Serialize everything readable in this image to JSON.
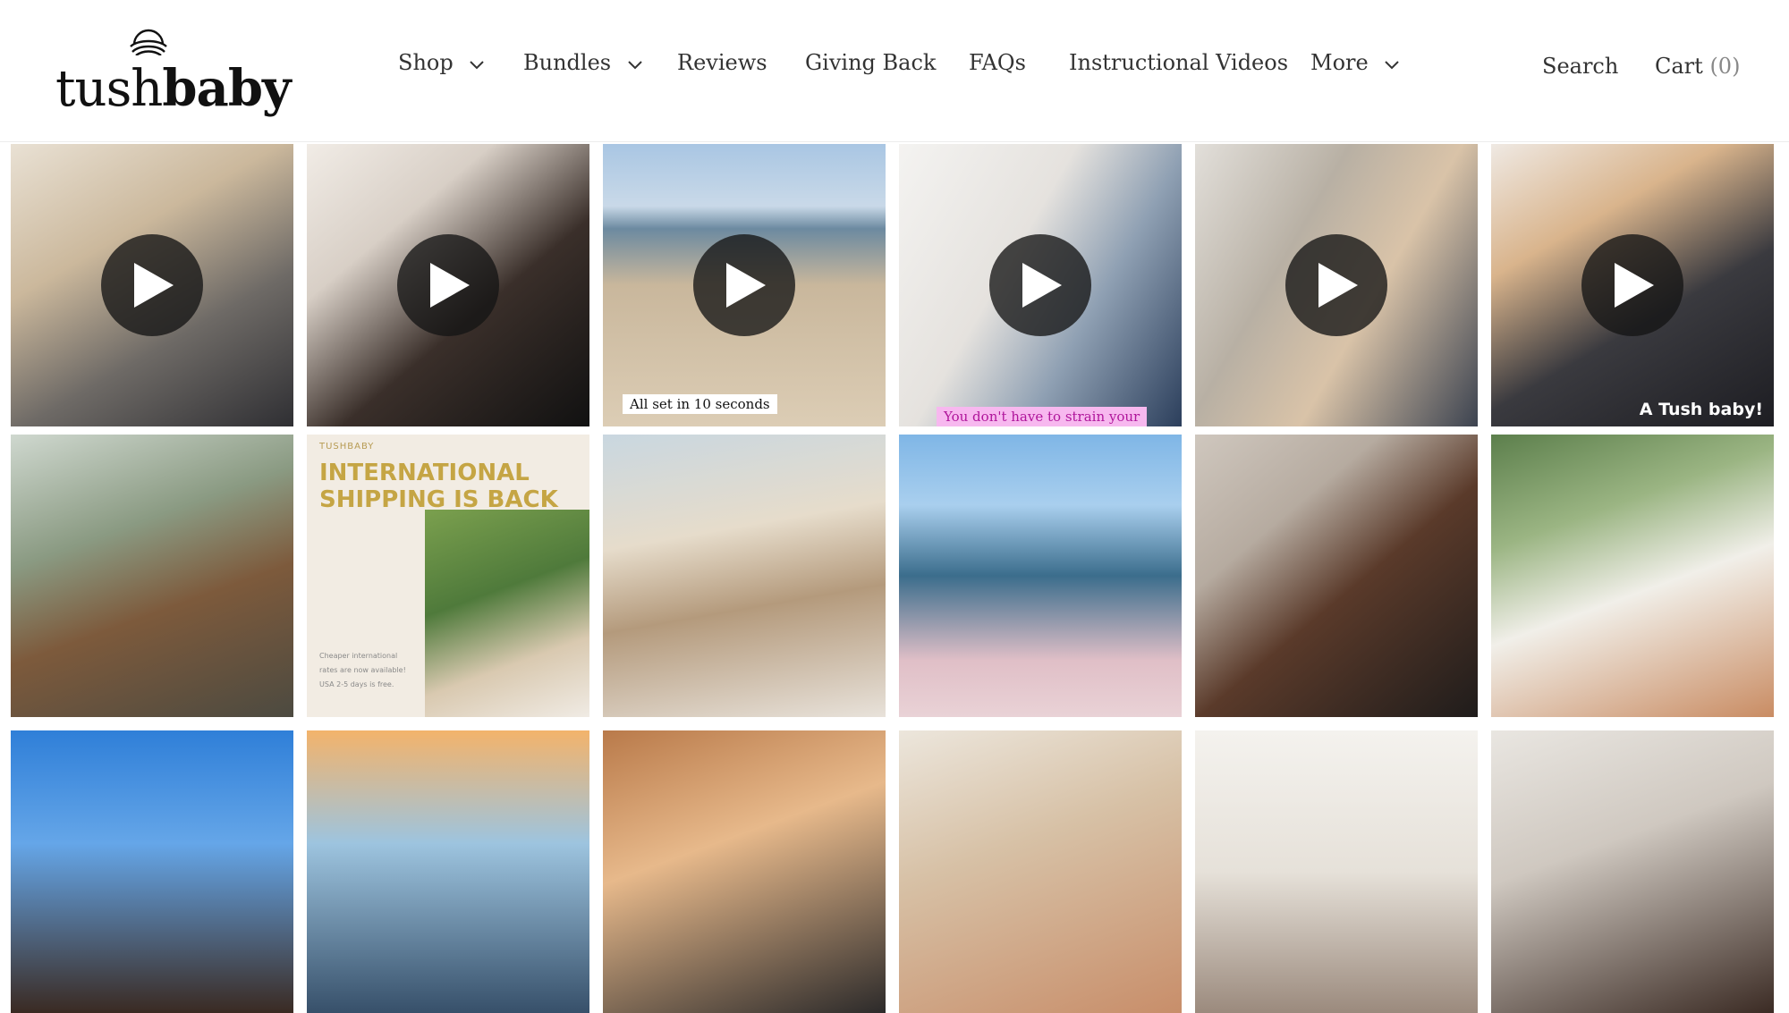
{
  "brand": {
    "logo_part1": "tush",
    "logo_part2": "baby"
  },
  "nav": {
    "items": [
      {
        "label": "Shop",
        "dropdown": true
      },
      {
        "label": "Bundles",
        "dropdown": true
      },
      {
        "label": "Reviews",
        "dropdown": false
      },
      {
        "label": "Giving Back",
        "dropdown": false
      },
      {
        "label": "FAQs",
        "dropdown": false
      },
      {
        "label": "Instructional Videos",
        "dropdown": false
      },
      {
        "label": "More",
        "dropdown": true
      }
    ],
    "search_label": "Search",
    "cart_label": "Cart",
    "cart_count": "(0)"
  },
  "gallery": {
    "tiles": [
      {
        "kind": "video",
        "caption": ""
      },
      {
        "kind": "video",
        "caption": ""
      },
      {
        "kind": "video",
        "caption": "All set in 10 seconds"
      },
      {
        "kind": "video",
        "caption": "You don't have to strain your"
      },
      {
        "kind": "video",
        "caption": ""
      },
      {
        "kind": "video",
        "caption": "A Tush baby!"
      },
      {
        "kind": "image"
      },
      {
        "kind": "promo",
        "brand": "TUSHBABY",
        "headline": "INTERNATIONAL SHIPPING IS BACK",
        "sub": "Cheaper international rates are now available! USA 2-5 days is free."
      },
      {
        "kind": "image"
      },
      {
        "kind": "image"
      },
      {
        "kind": "image"
      },
      {
        "kind": "image"
      },
      {
        "kind": "image"
      },
      {
        "kind": "image"
      },
      {
        "kind": "image"
      },
      {
        "kind": "image"
      },
      {
        "kind": "image"
      },
      {
        "kind": "image"
      }
    ]
  },
  "colors": {
    "caption_pink_bg": "#f7b8ef",
    "caption_pink_text": "#b0169b",
    "promo_gold": "#c5a544"
  },
  "icons": {
    "play": "play-icon",
    "chevron": "chevron-down-icon"
  }
}
